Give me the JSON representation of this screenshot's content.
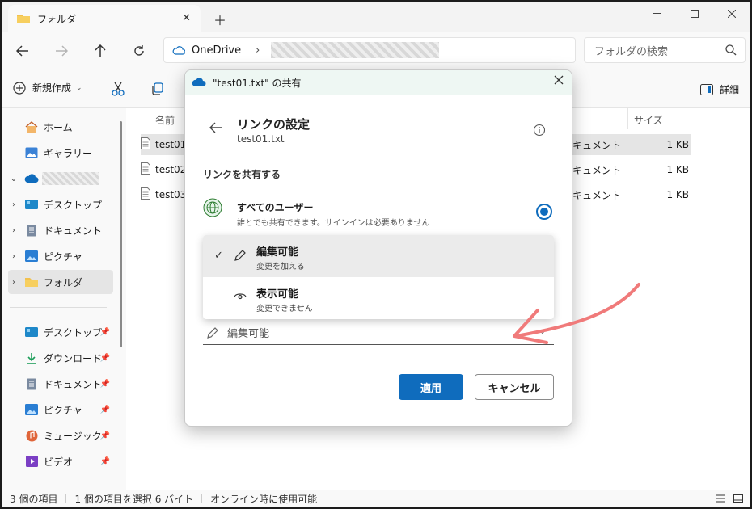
{
  "window": {
    "tab_title": "フォルダ",
    "close_glyph": "✕",
    "new_tab_glyph": "＋"
  },
  "address": {
    "location": "OneDrive",
    "search_placeholder": "フォルダの検索"
  },
  "commandbar": {
    "new_label": "新規作成",
    "details_label": "詳細"
  },
  "sidebar": {
    "home": "ホーム",
    "gallery": "ギャラリー",
    "desktop": "デスクトップ",
    "documents": "ドキュメント",
    "pictures": "ピクチャ",
    "folder": "フォルダ",
    "quick": [
      {
        "label": "デスクトップ"
      },
      {
        "label": "ダウンロード"
      },
      {
        "label": "ドキュメント"
      },
      {
        "label": "ピクチャ"
      },
      {
        "label": "ミュージック"
      },
      {
        "label": "ビデオ"
      }
    ]
  },
  "filelist": {
    "col_name": "名前",
    "col_size": "サイズ",
    "rows": [
      {
        "name": "test01",
        "type": "キュメント",
        "size": "1 KB"
      },
      {
        "name": "test02",
        "type": "キュメント",
        "size": "1 KB"
      },
      {
        "name": "test03",
        "type": "キュメント",
        "size": "1 KB"
      }
    ]
  },
  "status": {
    "count": "3 個の項目",
    "selection": "1 個の項目を選択  6 バイト",
    "availability": "オンライン時に使用可能"
  },
  "dialog": {
    "title": "\"test01.txt\" の共有",
    "heading": "リンクの設定",
    "filename": "test01.txt",
    "section_label": "リンクを共有する",
    "option_title": "すべてのユーザー",
    "option_sub": "誰とでも共有できます。サインインは必要ありません",
    "menu": [
      {
        "title": "編集可能",
        "sub": "変更を加える"
      },
      {
        "title": "表示可能",
        "sub": "変更できません"
      }
    ],
    "dropdown_value": "編集可能",
    "apply_label": "適用",
    "cancel_label": "キャンセル"
  },
  "colors": {
    "accent": "#0f6cbd",
    "annotation": "#f07a7a"
  }
}
